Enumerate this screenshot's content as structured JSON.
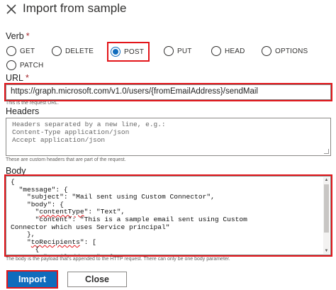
{
  "dialog": {
    "title": "Import from sample"
  },
  "verb": {
    "label": "Verb",
    "required_mark": "*",
    "options": [
      "GET",
      "DELETE",
      "POST",
      "PUT",
      "HEAD",
      "OPTIONS",
      "PATCH"
    ],
    "selected": "POST"
  },
  "url": {
    "label": "URL",
    "required_mark": "*",
    "value": "https://graph.microsoft.com/v1.0/users/{fromEmailAddress}/sendMail",
    "helper": "This is the request URL."
  },
  "headers": {
    "label": "Headers",
    "placeholder_lines": [
      "Headers separated by a new line, e.g.:",
      "Content-Type application/json",
      "Accept application/json"
    ],
    "helper": "These are custom headers that are part of the request."
  },
  "body": {
    "label": "Body",
    "helper": "The body is the payload that's appended to the HTTP request. There can only be one body parameter."
  },
  "buttons": {
    "import": "Import",
    "close": "Close"
  },
  "colors": {
    "accent": "#0f6cbd",
    "highlight": "#e3151a"
  }
}
